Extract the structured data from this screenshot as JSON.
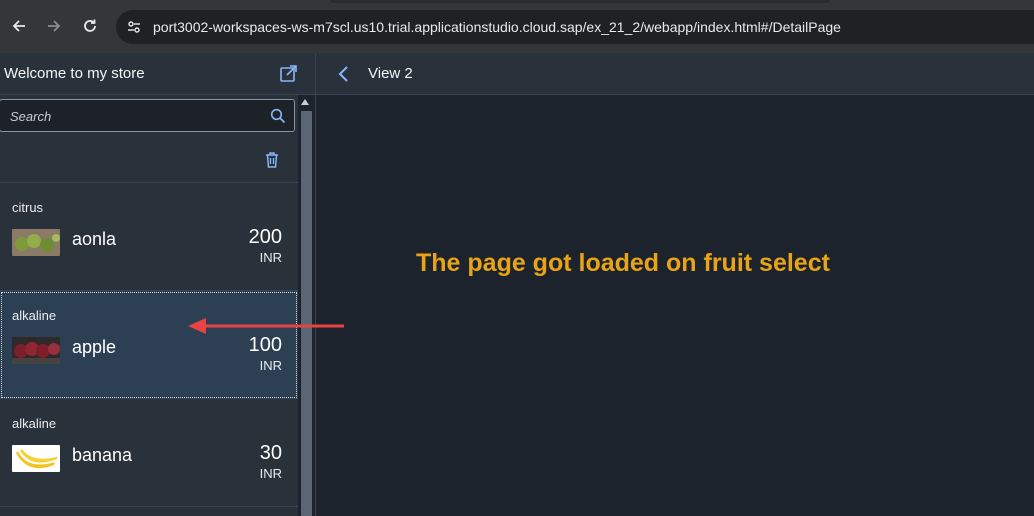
{
  "browser": {
    "url": "port3002-workspaces-ws-m7scl.us10.trial.applicationstudio.cloud.sap/ex_21_2/webapp/index.html#/DetailPage"
  },
  "master": {
    "title": "Welcome to my store",
    "search_placeholder": "Search",
    "items": [
      {
        "category": "citrus",
        "name": "aonla",
        "price": "200",
        "currency": "INR",
        "selected": false,
        "thumb_icon": "aonla-image"
      },
      {
        "category": "alkaline",
        "name": "apple",
        "price": "100",
        "currency": "INR",
        "selected": true,
        "thumb_icon": "apple-image"
      },
      {
        "category": "alkaline",
        "name": "banana",
        "price": "30",
        "currency": "INR",
        "selected": false,
        "thumb_icon": "banana-image"
      }
    ]
  },
  "detail": {
    "title": "View 2",
    "message": "The page got loaded on fruit select"
  },
  "colors": {
    "accent": "#8ab4f8",
    "message": "#e8a317",
    "annotation_arrow": "#e84343",
    "selected_row": "#2d4053"
  }
}
